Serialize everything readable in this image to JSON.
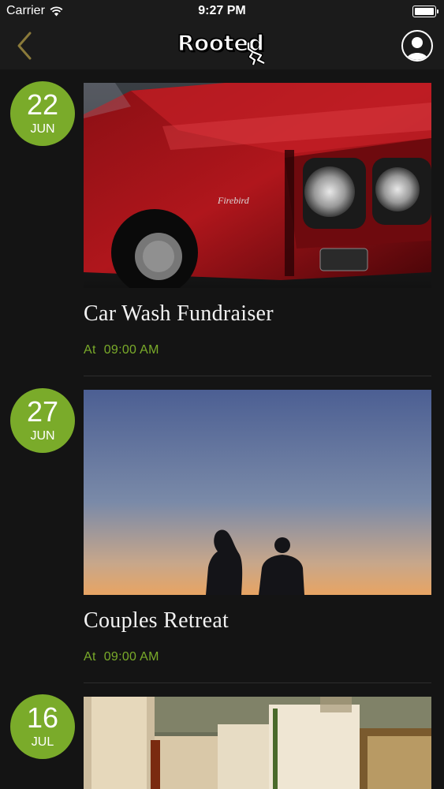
{
  "status_bar": {
    "carrier": "Carrier",
    "time": "9:27 PM"
  },
  "nav": {
    "logo_text": "Rooted",
    "back_icon": "chevron-left-icon",
    "profile_icon": "user-icon",
    "accent_color": "#8a7a3a"
  },
  "theme": {
    "badge_color": "#7aab2a",
    "time_color": "#7aab2a",
    "background": "#141414"
  },
  "events": [
    {
      "day": "22",
      "month": "JUN",
      "title": "Car Wash Fundraiser",
      "time_prefix": "At",
      "time": "09:00 AM",
      "image": "red-classic-car-photo"
    },
    {
      "day": "27",
      "month": "JUN",
      "title": "Couples Retreat",
      "time_prefix": "At",
      "time": "09:00 AM",
      "image": "couple-silhouette-sunset-photo"
    },
    {
      "day": "16",
      "month": "JUL",
      "title": "",
      "time_prefix": "",
      "time": "",
      "image": "old-books-photo"
    }
  ]
}
